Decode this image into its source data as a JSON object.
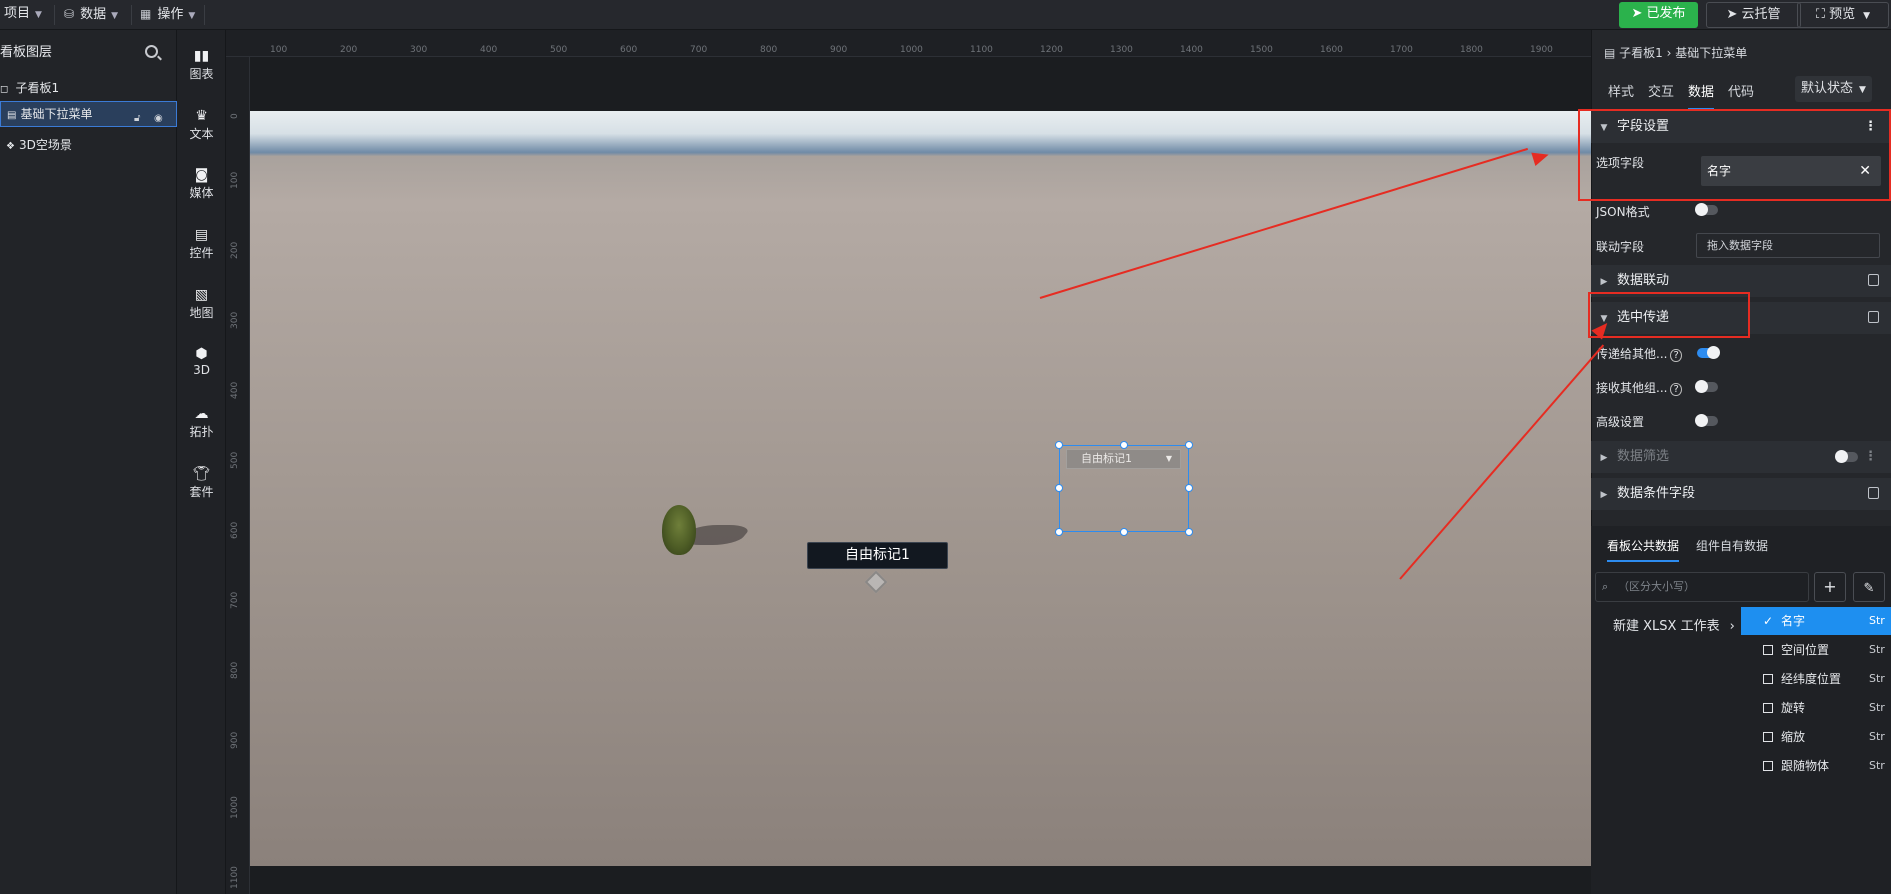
{
  "topbar": {
    "menu_project": "项目",
    "menu_data": "数据",
    "menu_ops": "操作",
    "published": "已发布",
    "cloud": "云托管",
    "preview": "预览"
  },
  "layers": {
    "title": "看板图层",
    "items": [
      "子看板1",
      "基础下拉菜单",
      "3D空场景"
    ]
  },
  "tools": [
    "图表",
    "文本",
    "媒体",
    "控件",
    "地图",
    "3D",
    "拓扑",
    "套件"
  ],
  "ruler": {
    "h": [
      "100",
      "200",
      "300",
      "400",
      "500",
      "600",
      "700",
      "800",
      "900",
      "1000",
      "1100",
      "1200",
      "1300",
      "1400",
      "1500",
      "1600",
      "1700",
      "1800",
      "1900"
    ],
    "v": [
      "0",
      "100",
      "200",
      "300",
      "400",
      "500",
      "600",
      "700",
      "800",
      "900",
      "1000",
      "1100"
    ]
  },
  "canvas": {
    "marker_label": "自由标记1",
    "dropdown_value": "自由标记1"
  },
  "panel": {
    "breadcrumb_parent": "子看板1",
    "breadcrumb_current": "基础下拉菜单",
    "tabs": [
      "样式",
      "交互",
      "数据",
      "代码"
    ],
    "state": "默认状态",
    "section_field": "字段设置",
    "option_field_label": "选项字段",
    "option_field_value": "名字",
    "json_label": "JSON格式",
    "link_field_label": "联动字段",
    "link_field_placeholder": "拖入数据字段",
    "section_linkage": "数据联动",
    "section_pass": "选中传递",
    "pass_to_label": "传递给其他...",
    "receive_label": "接收其他组...",
    "advanced_label": "高级设置",
    "section_filter": "数据筛选",
    "section_condition": "数据条件字段",
    "subtabs": [
      "看板公共数据",
      "组件自有数据"
    ],
    "search_placeholder": "（区分大小写）",
    "datasource": "新建 XLSX 工作表",
    "fields": [
      {
        "name": "名字",
        "type": "Str",
        "selected": true
      },
      {
        "name": "空间位置",
        "type": "Str",
        "selected": false
      },
      {
        "name": "经纬度位置",
        "type": "Str",
        "selected": false
      },
      {
        "name": "旋转",
        "type": "Str",
        "selected": false
      },
      {
        "name": "缩放",
        "type": "Str",
        "selected": false
      },
      {
        "name": "跟随物体",
        "type": "Str",
        "selected": false
      }
    ]
  },
  "colors": {
    "accent": "#2d8cf0",
    "published": "#2bb24c",
    "annotation": "#e62c22"
  }
}
